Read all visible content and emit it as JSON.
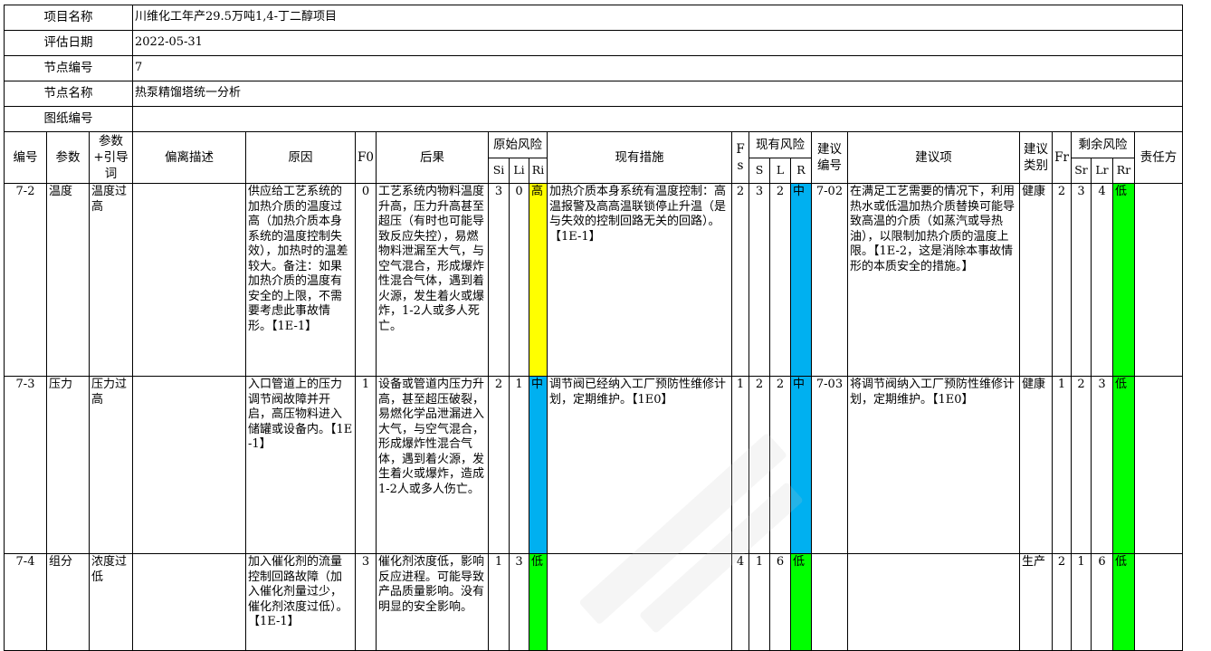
{
  "info": {
    "project_label": "项目名称",
    "project_value": "川维化工年产29.5万吨1,4-丁二醇项目",
    "date_label": "评估日期",
    "date_value": "2022-05-31",
    "node_no_label": "节点编号",
    "node_no_value": "7",
    "node_name_label": "节点名称",
    "node_name_value": "热泵精馏塔统一分析",
    "drawing_label": "图纸编号",
    "drawing_value": ""
  },
  "headers": {
    "no": "编号",
    "param": "参数",
    "guide": "参数+引导词",
    "deviation": "偏离描述",
    "cause": "原因",
    "f0": "F0",
    "consequence": "后果",
    "orig_risk": "原始风险",
    "si": "Si",
    "li": "Li",
    "ri": "Ri",
    "measures": "现有措施",
    "fs": "Fs",
    "curr_risk": "现有风险",
    "s": "S",
    "l": "L",
    "r": "R",
    "rec_no": "建议编号",
    "rec": "建议项",
    "rec_type": "建议类别",
    "fr": "Fr",
    "resid_risk": "剩余风险",
    "sr": "Sr",
    "lr": "Lr",
    "rr": "Rr",
    "owner": "责任方"
  },
  "rows": [
    {
      "no": "7-2",
      "param": "温度",
      "guide": "温度过高",
      "deviation": "",
      "cause": "供应给工艺系统的加热介质的温度过高（加热介质本身系统的温度控制失效），加热时的温差较大。备注：如果加热介质的温度有安全的上限，不需要考虑此事故情形。【1E-1】",
      "f0": "0",
      "consequence": "工艺系统内物料温度升高，压力升高甚至超压（有时也可能导致反应失控），易燃物料泄漏至大气，与空气混合，形成爆炸性混合气体，遇到着火源，发生着火或爆炸，1-2人或多人死亡。",
      "si": "3",
      "li": "0",
      "ri": "高",
      "measures": "加热介质本身系统有温度控制：高温报警及高高温联锁停止升温（是与失效的控制回路无关的回路）。【1E-1】",
      "fs": "2",
      "s": "3",
      "l": "2",
      "r": "中",
      "rec_no": "7-02",
      "rec": "在满足工艺需要的情况下，利用热水或低温加热介质替换可能导致高温的介质（如蒸汽或导热油），以限制加热介质的温度上限。【1E-2，这是消除本事故情形的本质安全的措施。】",
      "rec_type": "健康",
      "fr": "2",
      "sr": "3",
      "lr": "4",
      "rr": "低",
      "owner": ""
    },
    {
      "no": "7-3",
      "param": "压力",
      "guide": "压力过高",
      "deviation": "",
      "cause": "入口管道上的压力调节阀故障并开启，高压物料进入储罐或设备内。【1E-1】",
      "f0": "1",
      "consequence": "设备或管道内压力升高，甚至超压破裂，易燃化学品泄漏进入大气，与空气混合，形成爆炸性混合气体，遇到着火源，发生着火或爆炸，造成1-2人或多人伤亡。",
      "si": "2",
      "li": "1",
      "ri": "中",
      "measures": "调节阀已经纳入工厂预防性维修计划，定期维护。【1E0】",
      "fs": "1",
      "s": "2",
      "l": "2",
      "r": "中",
      "rec_no": "7-03",
      "rec": "将调节阀纳入工厂预防性维修计划，定期维护。【1E0】",
      "rec_type": "健康",
      "fr": "1",
      "sr": "2",
      "lr": "3",
      "rr": "低",
      "owner": ""
    },
    {
      "no": "7-4",
      "param": "组分",
      "guide": "浓度过低",
      "deviation": "",
      "cause": "加入催化剂的流量控制回路故障（加入催化剂量过少，催化剂浓度过低）。【1E-1】",
      "f0": "3",
      "consequence": "催化剂浓度低，影响反应进程。可能导致产品质量影响。没有明显的安全影响。",
      "si": "1",
      "li": "3",
      "ri": "低",
      "measures": "",
      "fs": "4",
      "s": "1",
      "l": "6",
      "r": "低",
      "rec_no": "",
      "rec": "",
      "rec_type": "生产",
      "fr": "2",
      "sr": "1",
      "lr": "6",
      "rr": "低",
      "owner": ""
    }
  ],
  "colors": {
    "high": "#ffff00",
    "medium": "#00b0f0",
    "low": "#00ff00"
  }
}
